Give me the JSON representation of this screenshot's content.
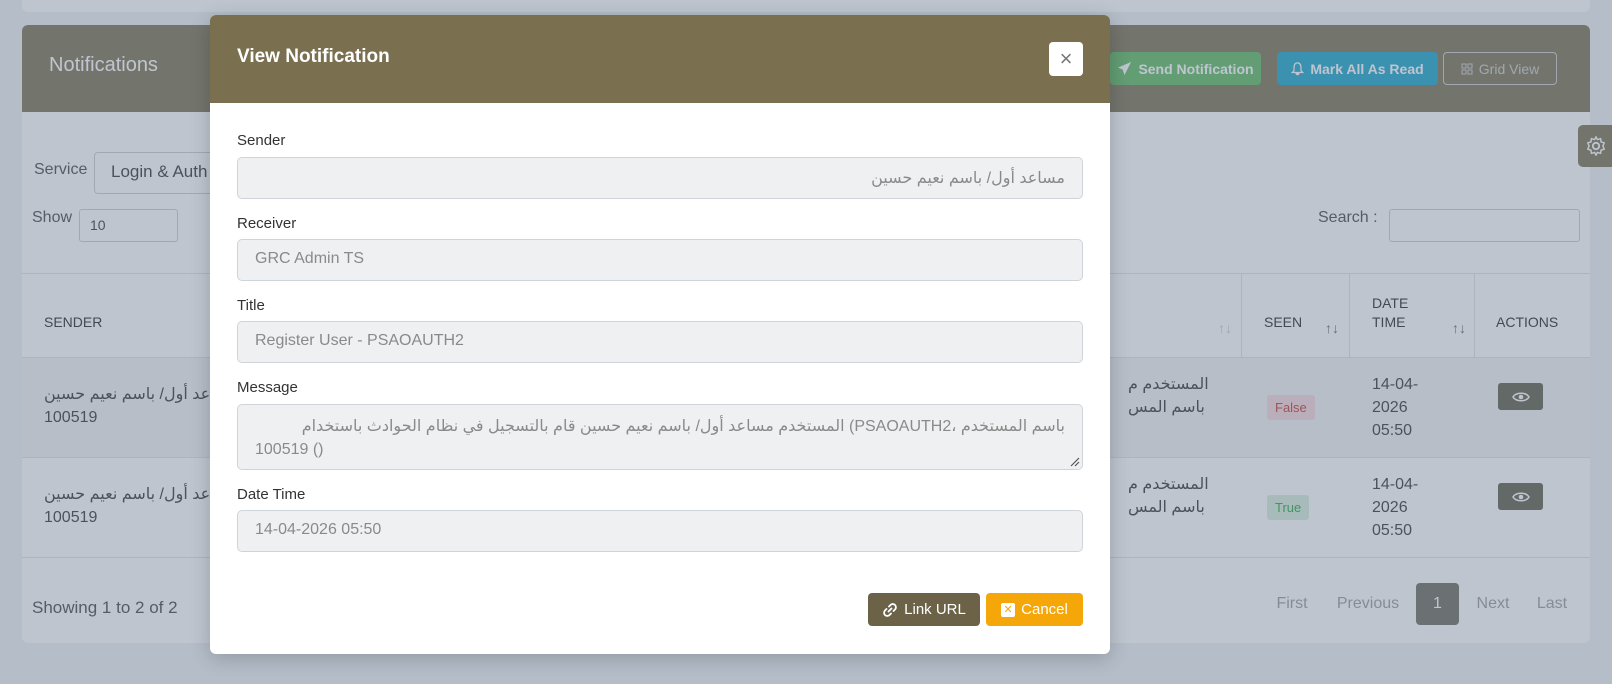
{
  "page": {
    "title": "Notifications",
    "header_buttons": {
      "send": "Send Notification",
      "mark_read": "Mark All As Read",
      "grid_view": "Grid View"
    },
    "filters": {
      "service_label": "Service",
      "service_value": "Login & Auth",
      "show_label": "Show",
      "show_value": "10",
      "search_label": "Search :"
    },
    "table": {
      "columns": [
        "SENDER",
        "SEEN",
        "DATE",
        "TIME",
        "ACTIONS"
      ],
      "rows": [
        {
          "sender_line1": "مساعد أول/ باسم نعيم حسين",
          "sender_line2": "100519",
          "msg_line1": "المستخدم م",
          "msg_line2": "باسم المس",
          "seen": "False",
          "date": "14-04-",
          "year": "2026",
          "time": "05:50"
        },
        {
          "sender_line1": "مساعد أول/ باسم نعيم حسين",
          "sender_line2": "100519",
          "msg_line1": "المستخدم م",
          "msg_line2": "باسم المس",
          "seen": "True",
          "date": "14-04-",
          "year": "2026",
          "time": "05:50"
        }
      ]
    },
    "footer": {
      "showing": "Showing 1 to 2 of 2",
      "pagination": [
        "First",
        "Previous",
        "1",
        "Next",
        "Last"
      ]
    }
  },
  "modal": {
    "title": "View Notification",
    "close_glyph": "×",
    "fields": {
      "sender": {
        "label": "Sender",
        "value": "مساعد أول/ باسم نعيم حسين"
      },
      "receiver": {
        "label": "Receiver",
        "value": "GRC Admin TS"
      },
      "title": {
        "label": "Title",
        "value": "Register User - PSAOAUTH2"
      },
      "message": {
        "label": "Message",
        "line1": "باسم المستخدم ،PSAOAUTH2) المستخدم مساعد أول/ باسم نعيم حسين قام بالتسجيل في نظام الحوادث باستخدام",
        "line2": "100519 ()"
      },
      "datetime": {
        "label": "Date Time",
        "value": "14-04-2026 05:50"
      }
    },
    "buttons": {
      "link": "Link URL",
      "cancel": "Cancel"
    }
  },
  "colors": {
    "brand": "#7a7050",
    "send": "#5cb85c",
    "mark_read": "#17a2c8",
    "cancel": "#f5a70a"
  },
  "icons": [
    "paper-plane-icon",
    "bell-icon",
    "grid-icon",
    "gear-icon",
    "eye-icon",
    "close-icon",
    "link-icon",
    "cancel-icon",
    "sort-icon"
  ]
}
